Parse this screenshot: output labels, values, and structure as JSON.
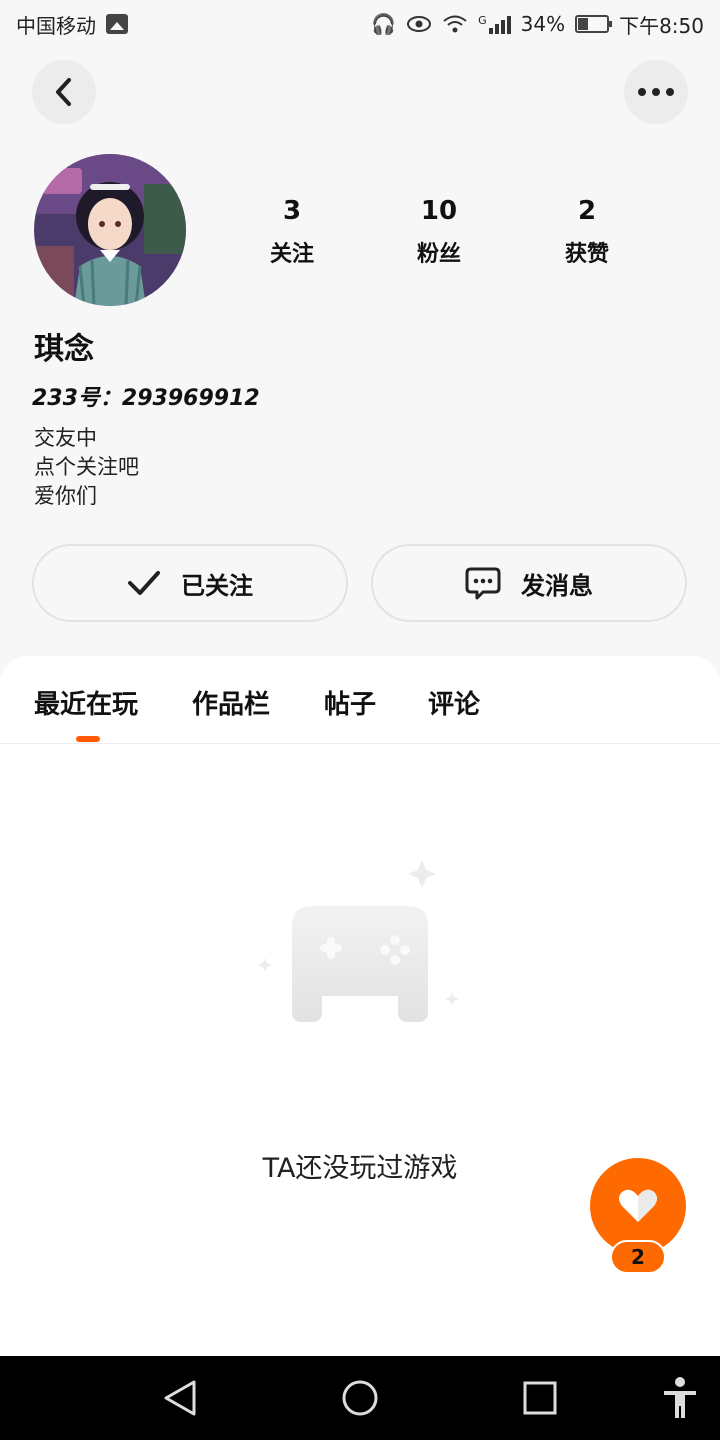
{
  "status_bar": {
    "carrier": "中国移动",
    "network": "G",
    "battery": "34%",
    "time": "下午8:50",
    "icons": [
      "gallery-icon",
      "headphones-icon",
      "eye-icon",
      "wifi-icon",
      "signal-icon",
      "battery-icon"
    ]
  },
  "header": {
    "back_icon": "chevron-left-icon",
    "more_icon": "more-dots-icon"
  },
  "profile": {
    "name": "琪念",
    "uid": "233号：293969912",
    "bio": [
      "交友中",
      "点个关注吧",
      "爱你们"
    ],
    "stats": [
      {
        "value": "3",
        "label": "关注"
      },
      {
        "value": "10",
        "label": "粉丝"
      },
      {
        "value": "2",
        "label": "获赞"
      }
    ]
  },
  "actions": {
    "follow_label": "已关注",
    "message_label": "发消息"
  },
  "tabs": [
    {
      "label": "最近在玩",
      "active": true
    },
    {
      "label": "作品栏",
      "active": false
    },
    {
      "label": "帖子",
      "active": false
    },
    {
      "label": "评论",
      "active": false
    }
  ],
  "empty_state": {
    "text": "TA还没玩过游戏",
    "icon": "gamepad-icon"
  },
  "like_fab": {
    "count": "2",
    "icon": "heart-icon"
  },
  "nav_bar": {
    "icons": [
      "back-triangle-icon",
      "home-circle-icon",
      "recents-square-icon",
      "accessibility-icon"
    ]
  },
  "colors": {
    "accent": "#ff6a00",
    "background": "#f7f7f7",
    "card": "#ffffff"
  }
}
